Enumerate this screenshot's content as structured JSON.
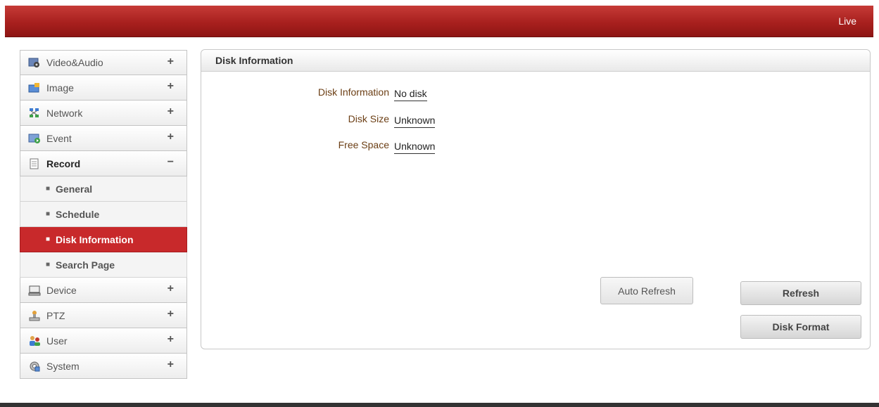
{
  "header": {
    "live_label": "Live"
  },
  "sidebar": {
    "items": [
      {
        "label": "Video&Audio",
        "sign": "+",
        "icon": "video-audio-icon"
      },
      {
        "label": "Image",
        "sign": "+",
        "icon": "image-icon"
      },
      {
        "label": "Network",
        "sign": "+",
        "icon": "network-icon"
      },
      {
        "label": "Event",
        "sign": "+",
        "icon": "event-icon"
      },
      {
        "label": "Record",
        "sign": "−",
        "icon": "record-icon"
      },
      {
        "label": "Device",
        "sign": "+",
        "icon": "device-icon"
      },
      {
        "label": "PTZ",
        "sign": "+",
        "icon": "ptz-icon"
      },
      {
        "label": "User",
        "sign": "+",
        "icon": "user-icon"
      },
      {
        "label": "System",
        "sign": "+",
        "icon": "system-icon"
      }
    ],
    "record_subitems": [
      {
        "label": "General"
      },
      {
        "label": "Schedule"
      },
      {
        "label": "Disk Information",
        "active": true
      },
      {
        "label": "Search Page"
      }
    ]
  },
  "panel": {
    "title": "Disk Information",
    "fields": [
      {
        "label": "Disk Information",
        "value": "No disk"
      },
      {
        "label": "Disk Size",
        "value": "Unknown"
      },
      {
        "label": "Free Space",
        "value": "Unknown"
      }
    ],
    "buttons": {
      "auto_refresh": "Auto Refresh",
      "refresh": "Refresh",
      "disk_format": "Disk Format"
    }
  },
  "colors": {
    "header_red": "#a8201e",
    "active_item": "#c8292b",
    "field_label": "#6b3e14"
  }
}
